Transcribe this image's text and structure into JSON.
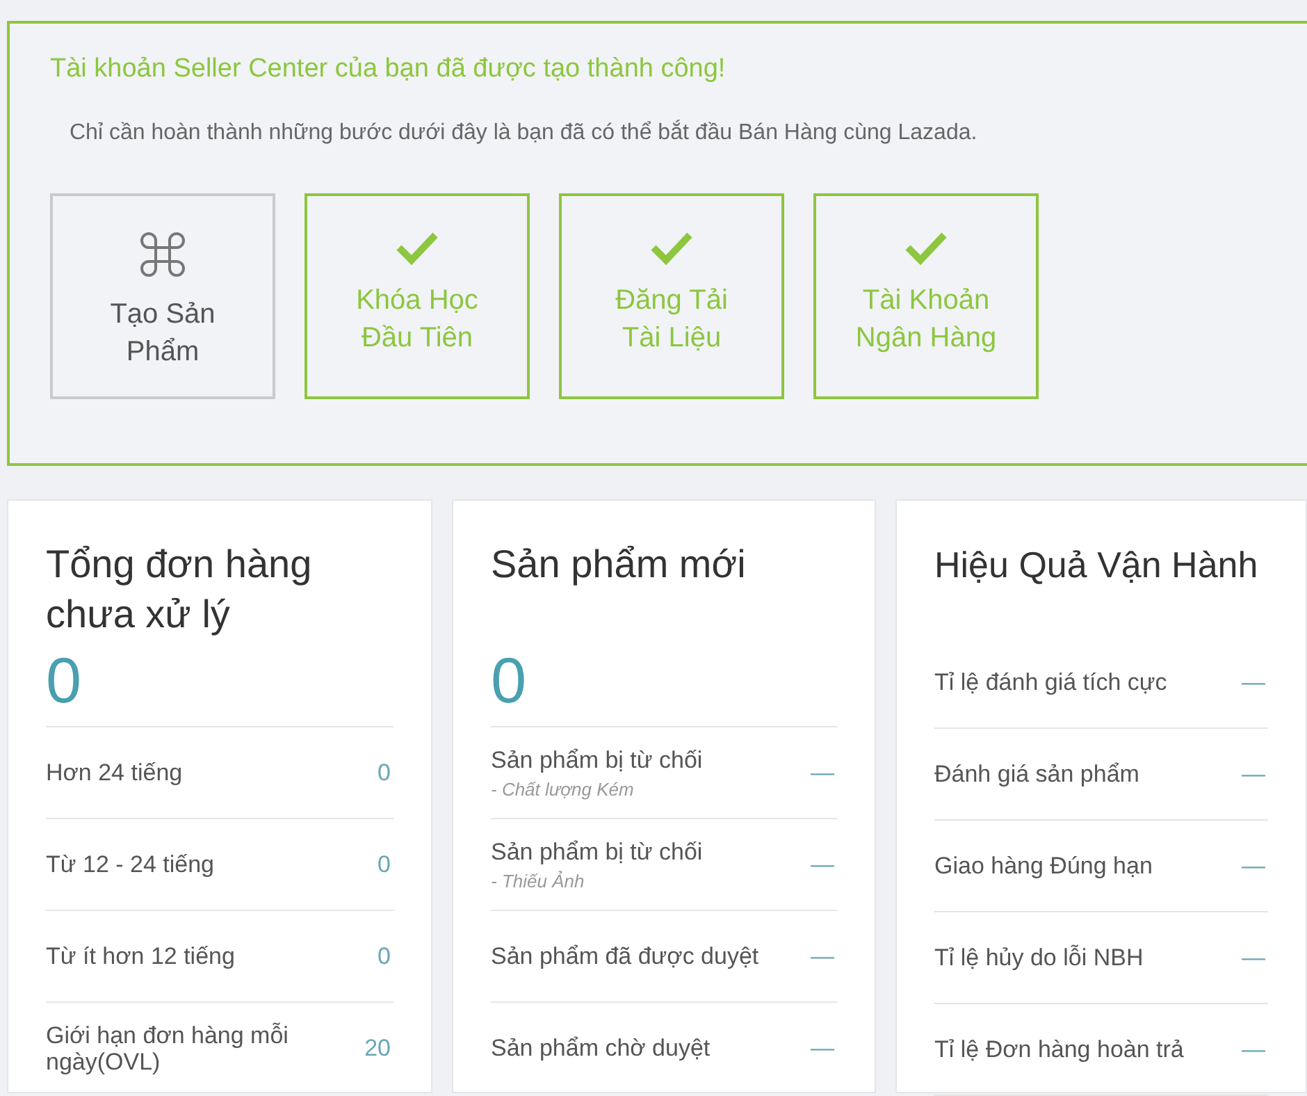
{
  "onboarding": {
    "title": "Tài khoản Seller Center của bạn đã được tạo thành công!",
    "subtitle": "Chỉ cần hoàn thành những bước dưới đây là bạn đã có thể bắt đầu Bán Hàng cùng Lazada.",
    "steps": [
      {
        "label": "Tạo Sản Phẩm",
        "completed": false
      },
      {
        "label": "Khóa Học Đầu Tiên",
        "completed": true
      },
      {
        "label": "Đăng Tải Tài Liệu",
        "completed": true
      },
      {
        "label": "Tài Khoản Ngân Hàng",
        "completed": true
      }
    ]
  },
  "cards": [
    {
      "title": "Tổng đơn hàng chưa xử lý",
      "metric": "0",
      "rows": [
        {
          "label": "Hơn 24 tiếng",
          "value": "0"
        },
        {
          "label": "Từ 12 - 24 tiếng",
          "value": "0"
        },
        {
          "label": "Từ ít hơn 12 tiếng",
          "value": "0"
        },
        {
          "label": "Giới hạn đơn hàng mỗi ngày(OVL)",
          "value": "20"
        }
      ]
    },
    {
      "title": "Sản phẩm mới",
      "metric": "0",
      "rows": [
        {
          "label": "Sản phẩm bị từ chối",
          "note": "- Chất lượng Kém",
          "value": "—"
        },
        {
          "label": "Sản phẩm bị từ chối",
          "note": "- Thiếu Ảnh",
          "value": "—"
        },
        {
          "label": "Sản phẩm đã được duyệt",
          "value": "—"
        },
        {
          "label": "Sản phẩm chờ duyệt",
          "value": "—"
        }
      ]
    },
    {
      "title": "Hiệu Quả Vận Hành",
      "rows": [
        {
          "label": "Tỉ lệ đánh giá tích cực",
          "value": "—"
        },
        {
          "label": "Đánh giá sản phẩm",
          "value": "—"
        },
        {
          "label": "Giao hàng Đúng hạn",
          "value": "—"
        },
        {
          "label": "Tỉ lệ hủy do lỗi NBH",
          "value": "—"
        },
        {
          "label": "Tỉ lệ Đơn hàng hoàn trả",
          "value": "—"
        }
      ]
    }
  ]
}
